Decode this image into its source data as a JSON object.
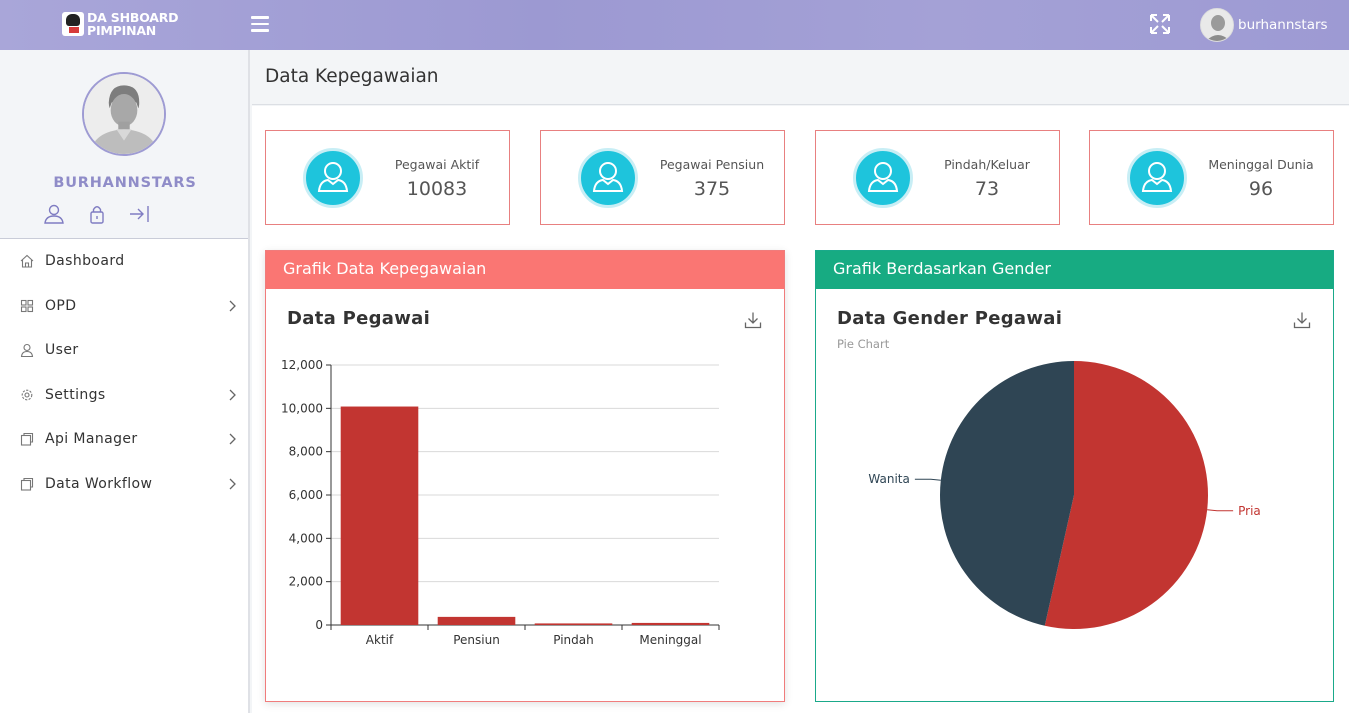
{
  "brand": {
    "line1": "DA SHBOARD",
    "line2": "PIMPINAN"
  },
  "topbar": {
    "username": "burhannstars"
  },
  "sidebar": {
    "profile_name": "BURHANNSTARS",
    "items": [
      {
        "label": "Dashboard",
        "icon": "home-icon",
        "has_children": false
      },
      {
        "label": "OPD",
        "icon": "grid-icon",
        "has_children": true
      },
      {
        "label": "User",
        "icon": "user-icon",
        "has_children": false
      },
      {
        "label": "Settings",
        "icon": "gear-icon",
        "has_children": true
      },
      {
        "label": "Api Manager",
        "icon": "copy-icon",
        "has_children": true
      },
      {
        "label": "Data Workflow",
        "icon": "copy-icon",
        "has_children": true
      }
    ]
  },
  "page": {
    "title": "Data Kepegawaian"
  },
  "stats": [
    {
      "label": "Pegawai Aktif",
      "value": "10083"
    },
    {
      "label": "Pegawai Pensiun",
      "value": "375"
    },
    {
      "label": "Pindah/Keluar",
      "value": "73"
    },
    {
      "label": "Meninggal Dunia",
      "value": "96"
    }
  ],
  "panels": {
    "left": {
      "header": "Grafik Data Kepegawaian"
    },
    "right": {
      "header": "Grafik Berdasarkan Gender"
    }
  },
  "colors": {
    "topbar": "#a29fd6",
    "stat_icon": "#1ec4dc",
    "bar": "#c23531",
    "pie_pria": "#c23531",
    "pie_wanita": "#2f4554",
    "left_header": "#fa7673",
    "right_header": "#17ab82"
  },
  "chart_data": [
    {
      "type": "bar",
      "title": "Data Pegawai",
      "categories": [
        "Aktif",
        "Pensiun",
        "Pindah",
        "Meninggal"
      ],
      "values": [
        10083,
        375,
        73,
        96
      ],
      "ylim": [
        0,
        12000
      ],
      "yticks": [
        "0",
        "2,000",
        "4,000",
        "6,000",
        "8,000",
        "10,000",
        "12,000"
      ],
      "grid": true
    },
    {
      "type": "pie",
      "title": "Data Gender Pegawai",
      "subtitle": "Pie Chart",
      "labels": [
        "Pria",
        "Wanita"
      ],
      "values": [
        53.5,
        46.5
      ]
    }
  ]
}
